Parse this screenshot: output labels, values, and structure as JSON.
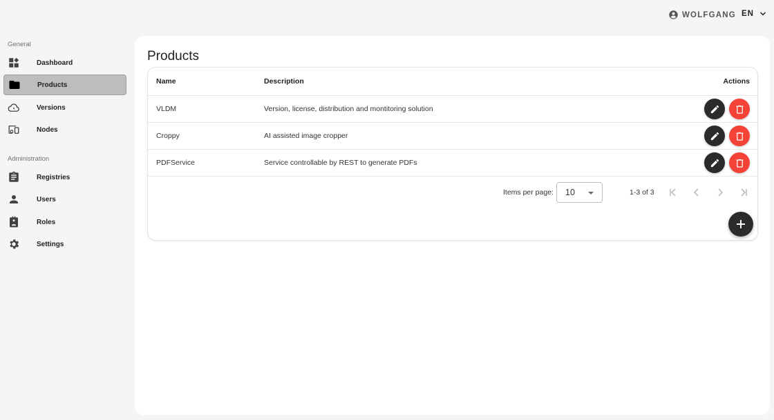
{
  "header": {
    "user_name": "WOLFGANG",
    "language": "EN"
  },
  "sidebar": {
    "sections": [
      {
        "label": "General",
        "items": [
          {
            "label": "Dashboard",
            "icon": "dashboard-icon",
            "active": false
          },
          {
            "label": "Products",
            "icon": "folder-icon",
            "active": true
          },
          {
            "label": "Versions",
            "icon": "cloud-icon",
            "active": false
          },
          {
            "label": "Nodes",
            "icon": "devices-icon",
            "active": false
          }
        ]
      },
      {
        "label": "Administration",
        "items": [
          {
            "label": "Registries",
            "icon": "clipboard-icon",
            "active": false
          },
          {
            "label": "Users",
            "icon": "person-icon",
            "active": false
          },
          {
            "label": "Roles",
            "icon": "badge-icon",
            "active": false
          },
          {
            "label": "Settings",
            "icon": "gear-icon",
            "active": false
          }
        ]
      }
    ]
  },
  "main": {
    "title": "Products",
    "table": {
      "columns": [
        "Name",
        "Description",
        "Actions"
      ],
      "rows": [
        {
          "name": "VLDM",
          "description": "Version, license, distribution and montitoring solution"
        },
        {
          "name": "Croppy",
          "description": "AI assisted image cropper"
        },
        {
          "name": "PDFService",
          "description": "Service controllable by REST to generate PDFs"
        }
      ]
    },
    "paginator": {
      "items_per_page_label": "Items per page:",
      "items_per_page_value": "10",
      "range_label": "1-3 of 3"
    }
  },
  "colors": {
    "edit_button": "#2b2b2b",
    "delete_button": "#f44336",
    "active_nav": "#bdbdbd"
  }
}
